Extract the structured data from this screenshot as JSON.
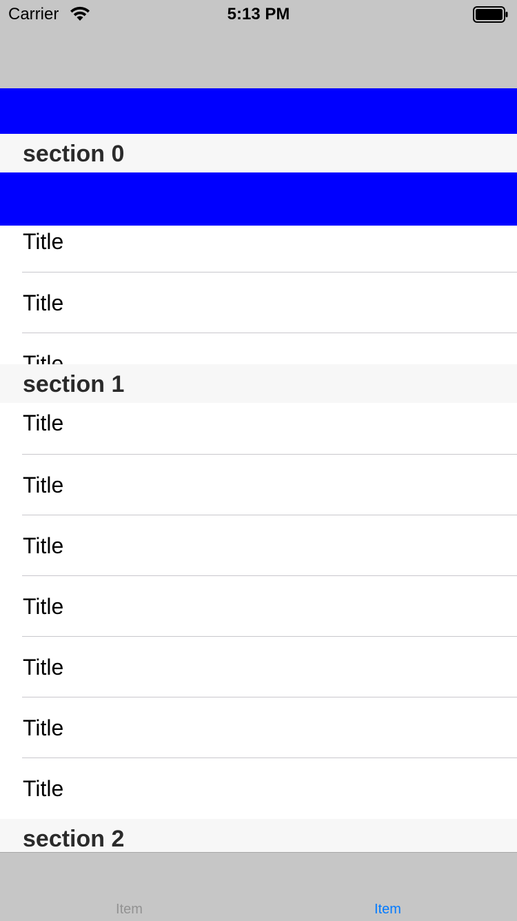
{
  "status_bar": {
    "carrier": "Carrier",
    "time": "5:13 PM",
    "wifi_icon": "wifi-icon",
    "battery_icon": "battery-icon"
  },
  "colors": {
    "nav_background": "#c6c6c6",
    "header_band": "#0000ff",
    "section_header_bg": "#f7f7f7",
    "tab_active": "#007aff",
    "tab_inactive": "#929292"
  },
  "table": {
    "sections": [
      {
        "header": "section 0",
        "rows": [
          "Title",
          "Title",
          "Title"
        ]
      },
      {
        "header": "section 1",
        "rows": [
          "Title",
          "Title",
          "Title",
          "Title",
          "Title",
          "Title",
          "Title"
        ]
      },
      {
        "header": "section 2",
        "rows": []
      }
    ]
  },
  "tab_bar": {
    "items": [
      {
        "label": "Item",
        "selected": false
      },
      {
        "label": "Item",
        "selected": true
      }
    ]
  }
}
